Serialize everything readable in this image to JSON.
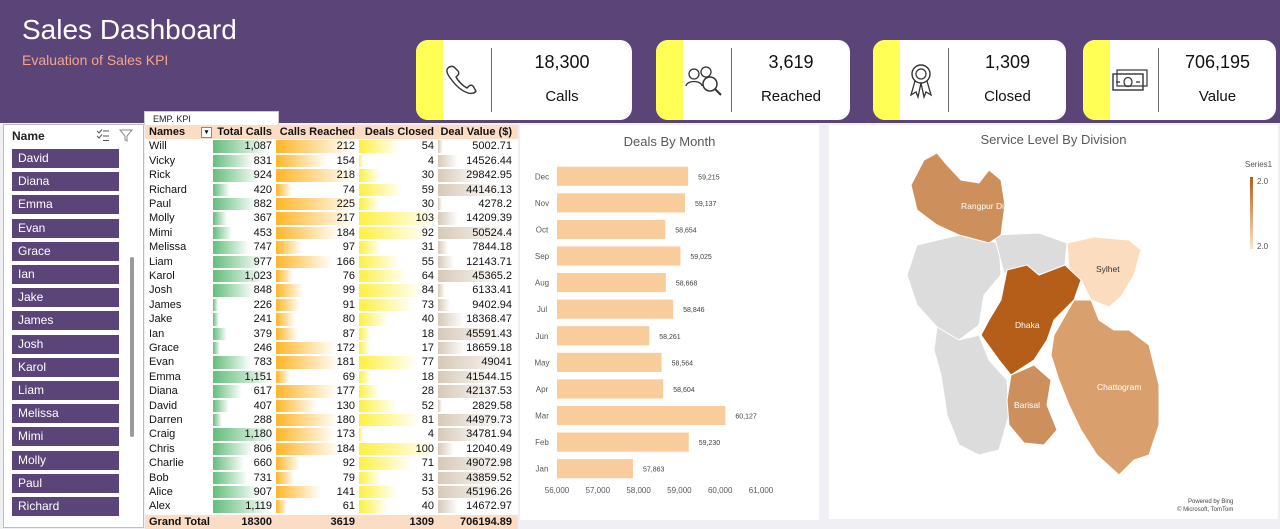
{
  "header": {
    "title": "Sales Dashboard",
    "subtitle": "Evaluation of Sales KPI"
  },
  "kpis": [
    {
      "value": "18,300",
      "label": "Calls",
      "icon": "phone-icon"
    },
    {
      "value": "3,619",
      "label": "Reached",
      "icon": "people-search-icon"
    },
    {
      "value": "1,309",
      "label": "Closed",
      "icon": "award-ribbon-icon"
    },
    {
      "value": "706,195",
      "label": "Value",
      "icon": "money-icon"
    }
  ],
  "slicer": {
    "title": "Name",
    "items": [
      "David",
      "Diana",
      "Emma",
      "Evan",
      "Grace",
      "Ian",
      "Jake",
      "James",
      "Josh",
      "Karol",
      "Liam",
      "Melissa",
      "Mimi",
      "Molly",
      "Paul",
      "Richard"
    ]
  },
  "table": {
    "tab_label": "EMP. KPI",
    "headers": [
      "Names",
      "Total Calls",
      "Calls Reached",
      "Deals Closed",
      "Deal Value ($)"
    ],
    "rows": [
      [
        "Will",
        "1,087",
        "212",
        "54",
        "5002.71"
      ],
      [
        "Vicky",
        "831",
        "154",
        "4",
        "14526.44"
      ],
      [
        "Rick",
        "924",
        "218",
        "30",
        "29842.95"
      ],
      [
        "Richard",
        "420",
        "74",
        "59",
        "44146.13"
      ],
      [
        "Paul",
        "882",
        "225",
        "30",
        "4278.2"
      ],
      [
        "Molly",
        "367",
        "217",
        "103",
        "14209.39"
      ],
      [
        "Mimi",
        "453",
        "184",
        "92",
        "50524.4"
      ],
      [
        "Melissa",
        "747",
        "97",
        "31",
        "7844.18"
      ],
      [
        "Liam",
        "977",
        "166",
        "55",
        "12143.71"
      ],
      [
        "Karol",
        "1,023",
        "76",
        "64",
        "45365.2"
      ],
      [
        "Josh",
        "848",
        "99",
        "84",
        "6133.41"
      ],
      [
        "James",
        "226",
        "91",
        "73",
        "9402.94"
      ],
      [
        "Jake",
        "241",
        "80",
        "40",
        "18368.47"
      ],
      [
        "Ian",
        "379",
        "87",
        "18",
        "45591.43"
      ],
      [
        "Grace",
        "246",
        "172",
        "17",
        "18659.18"
      ],
      [
        "Evan",
        "783",
        "181",
        "77",
        "49041"
      ],
      [
        "Emma",
        "1,151",
        "69",
        "18",
        "41544.15"
      ],
      [
        "Diana",
        "617",
        "177",
        "28",
        "42137.53"
      ],
      [
        "David",
        "407",
        "130",
        "52",
        "2829.58"
      ],
      [
        "Darren",
        "288",
        "180",
        "81",
        "44979.73"
      ],
      [
        "Craig",
        "1,180",
        "173",
        "4",
        "34781.94"
      ],
      [
        "Chris",
        "806",
        "184",
        "100",
        "12040.49"
      ],
      [
        "Charlie",
        "660",
        "92",
        "71",
        "49072.98"
      ],
      [
        "Bob",
        "731",
        "79",
        "31",
        "43859.52"
      ],
      [
        "Alice",
        "907",
        "141",
        "53",
        "45196.26"
      ],
      [
        "Alex",
        "1,119",
        "61",
        "40",
        "14672.97"
      ]
    ],
    "total": [
      "Grand Total",
      "18300",
      "3619",
      "1309",
      "706194.89"
    ],
    "bar_colors": [
      "#63be7b",
      "#ffb628",
      "#ffef42",
      "#d7c9b8"
    ]
  },
  "chart_data": [
    {
      "type": "bar",
      "title": "Deals By Month",
      "categories": [
        "Jan",
        "Feb",
        "Mar",
        "Apr",
        "May",
        "Jun",
        "Jul",
        "Aug",
        "Sep",
        "Oct",
        "Nov",
        "Dec"
      ],
      "values": [
        57863,
        59230,
        60127,
        58604,
        58564,
        58261,
        58846,
        58668,
        59025,
        58654,
        59137,
        59215
      ],
      "value_labels": [
        "57,863",
        "59,230",
        "60,127",
        "58,604",
        "58,564",
        "58,261",
        "58,846",
        "58,668",
        "59,025",
        "58,654",
        "59,137",
        "59,215"
      ],
      "xlim": [
        56000,
        61000
      ],
      "x_ticks": [
        "56,000",
        "57,000",
        "58,000",
        "59,000",
        "60,000",
        "61,000"
      ],
      "orientation": "horizontal",
      "bar_color": "#f9cc9c"
    },
    {
      "type": "map",
      "title": "Service Level By Division",
      "legend_title": "Series1",
      "legend_max": "2.0",
      "legend_min": "2.0",
      "regions": [
        "Rangpur Division",
        "Sylhet",
        "Dhaka",
        "Barisal",
        "Chattogram"
      ],
      "credit_line1": "Powered by Bing",
      "credit_line2": "© Microsoft, TomTom"
    }
  ]
}
